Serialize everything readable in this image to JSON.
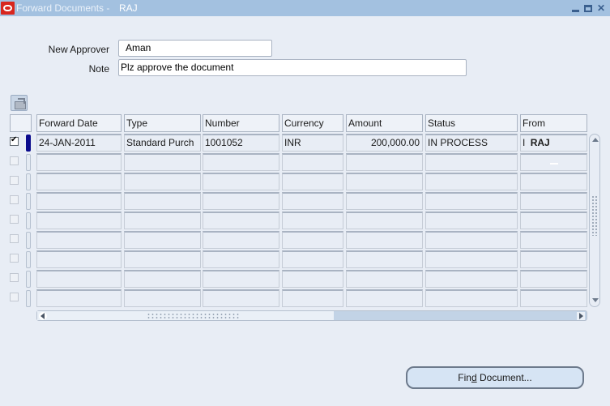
{
  "window": {
    "title": "Forward Documents -",
    "user": "RAJ",
    "controls": [
      "minimize",
      "maximize",
      "close"
    ]
  },
  "form": {
    "new_approver_label": "New Approver",
    "new_approver_value": "Aman",
    "note_label": "Note",
    "note_value": "Plz approve the document"
  },
  "toolbar": {
    "folder_icon": "folder-open-icon"
  },
  "table": {
    "columns": [
      "Forward Date",
      "Type",
      "Number",
      "Currency",
      "Amount",
      "Status",
      "From"
    ],
    "rows": [
      {
        "selected": true,
        "current": true,
        "forward_date": "24-JAN-2011",
        "type": "Standard Purch",
        "number": "1001052",
        "currency": "INR",
        "amount": "200,000.00",
        "status": "IN PROCESS",
        "from_prefix": "I",
        "from": "RAJ"
      },
      {
        "selected": false
      },
      {
        "selected": false
      },
      {
        "selected": false
      },
      {
        "selected": false
      },
      {
        "selected": false
      },
      {
        "selected": false
      },
      {
        "selected": false
      },
      {
        "selected": false
      }
    ]
  },
  "buttons": {
    "find_document_pre": "Fin",
    "find_document_mnemonic": "d",
    "find_document_post": " Document..."
  }
}
